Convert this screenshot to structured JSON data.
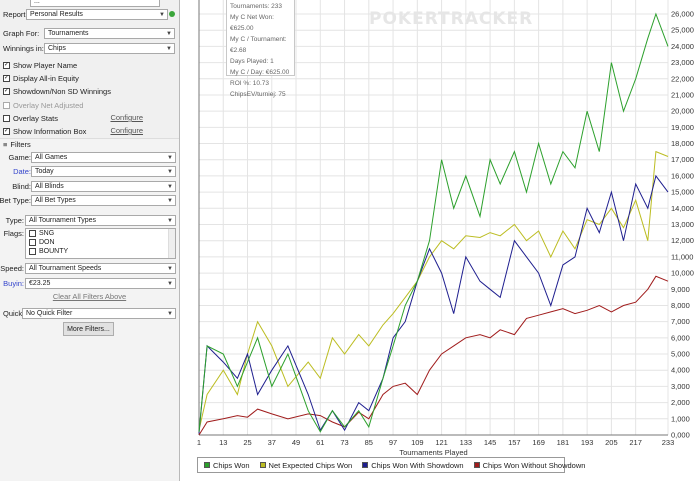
{
  "sidebar": {
    "top_value": "...",
    "report": {
      "label": "Report:",
      "value": "Personal Results"
    },
    "graph_for": {
      "label": "Graph For:",
      "value": "Tournaments"
    },
    "winnings_in": {
      "label": "Winnings in:",
      "value": "Chips"
    },
    "checks": {
      "show_player_name": "Show Player Name",
      "display_allin_equity": "Display All-in Equity",
      "showdown_winnings": "Showdown/Non SD Winnings",
      "overlay_net_adjusted": "Overlay Net Adjusted",
      "overlay_stats": "Overlay Stats",
      "show_info_box": "Show Information Box",
      "configure": "Configure"
    },
    "filters": {
      "header": "Filters",
      "game": {
        "label": "Game:",
        "value": "All Games"
      },
      "date": {
        "label": "Date:",
        "value": "Today"
      },
      "blind": {
        "label": "Blind:",
        "value": "All Blinds"
      },
      "bet_type": {
        "label": "Bet Type:",
        "value": "All Bet Types"
      },
      "type": {
        "label": "Type:",
        "value": "All Tournament Types"
      },
      "flags": {
        "label": "Flags:",
        "items": [
          "SNG",
          "DON",
          "BOUNTY"
        ]
      },
      "speed": {
        "label": "Speed:",
        "value": "All Tournament Speeds"
      },
      "buyin": {
        "label": "Buyin:",
        "value": "€23.25"
      },
      "clear_all": "Clear All Filters Above",
      "quick": {
        "label": "Quick:",
        "value": "No Quick Filter"
      },
      "more_filters": "More Filters..."
    }
  },
  "info_box": {
    "lines": [
      "Tournaments: 233",
      "My C Net Won: €625.00",
      "My C / Tournament: €2.68",
      "Days Played: 1",
      "My C / Day: €625.00",
      "ROI %: 10.73",
      "ChipsEV/turniej: 75"
    ]
  },
  "watermark": "POKERTRACKER",
  "chart_data": {
    "type": "line",
    "xlabel": "Tournaments Played",
    "x_ticks": [
      1,
      13,
      25,
      37,
      49,
      61,
      73,
      85,
      97,
      109,
      121,
      133,
      145,
      157,
      169,
      181,
      193,
      205,
      217,
      233
    ],
    "xlim": [
      1,
      233
    ],
    "ylim": [
      0,
      26000
    ],
    "y_ticks": [
      0,
      1000,
      2000,
      3000,
      4000,
      5000,
      6000,
      7000,
      8000,
      9000,
      10000,
      11000,
      12000,
      13000,
      14000,
      15000,
      16000,
      17000,
      18000,
      19000,
      20000,
      21000,
      22000,
      23000,
      24000,
      25000,
      26000
    ],
    "y_tick_labels": [
      "0,000",
      "1,000",
      "2,000",
      "3,000",
      "4,000",
      "5,000",
      "6,000",
      "7,000",
      "8,000",
      "9,000",
      "10,000",
      "11,000",
      "12,000",
      "13,000",
      "14,000",
      "15,000",
      "16,000",
      "17,000",
      "18,000",
      "19,000",
      "20,000",
      "21,000",
      "22,000",
      "23,000",
      "24,000",
      "25,000",
      "26,000"
    ],
    "grid": true,
    "series": [
      {
        "name": "Chips Won",
        "color": "#2ca02c",
        "x": [
          1,
          5,
          13,
          20,
          25,
          30,
          37,
          45,
          55,
          61,
          67,
          73,
          80,
          85,
          92,
          97,
          103,
          109,
          115,
          121,
          127,
          133,
          140,
          145,
          150,
          157,
          163,
          169,
          175,
          181,
          187,
          193,
          199,
          205,
          211,
          217,
          223,
          227,
          233
        ],
        "y": [
          200,
          5500,
          5000,
          3000,
          4500,
          6000,
          3000,
          5000,
          1500,
          200,
          1500,
          500,
          1500,
          500,
          3500,
          5500,
          8000,
          9500,
          12000,
          17000,
          14000,
          16000,
          13500,
          17000,
          15500,
          17500,
          15000,
          18000,
          15500,
          17500,
          16500,
          20000,
          17500,
          23000,
          20000,
          22000,
          24500,
          26000,
          24000
        ]
      },
      {
        "name": "Net Expected Chips Won",
        "color": "#bcbd22",
        "x": [
          1,
          5,
          13,
          20,
          25,
          30,
          37,
          45,
          55,
          61,
          67,
          73,
          80,
          85,
          92,
          97,
          103,
          109,
          115,
          121,
          127,
          133,
          140,
          145,
          150,
          157,
          163,
          169,
          175,
          181,
          187,
          193,
          199,
          205,
          211,
          217,
          223,
          227,
          233
        ],
        "y": [
          300,
          2500,
          4000,
          2500,
          5000,
          7000,
          5500,
          3000,
          4500,
          3500,
          6000,
          5000,
          6200,
          5500,
          6800,
          7500,
          8500,
          9500,
          11000,
          12000,
          11500,
          12300,
          12200,
          12500,
          12300,
          13000,
          12000,
          12600,
          11000,
          12600,
          11500,
          13300,
          13000,
          14000,
          12800,
          14500,
          12000,
          17500,
          17200
        ]
      },
      {
        "name": "Chips Won With Showdown",
        "color": "#1f1f8f",
        "x": [
          1,
          5,
          13,
          20,
          25,
          30,
          37,
          45,
          55,
          61,
          67,
          73,
          80,
          85,
          92,
          97,
          103,
          109,
          115,
          121,
          127,
          133,
          140,
          145,
          150,
          157,
          163,
          169,
          175,
          181,
          187,
          193,
          199,
          205,
          211,
          217,
          223,
          227,
          233
        ],
        "y": [
          100,
          5500,
          4500,
          3500,
          5000,
          2500,
          4000,
          5500,
          2500,
          300,
          1500,
          300,
          2000,
          1500,
          3500,
          6000,
          7000,
          9500,
          11500,
          10000,
          7500,
          11000,
          9500,
          9000,
          8500,
          12000,
          11000,
          10000,
          8000,
          10500,
          11000,
          14000,
          12500,
          15000,
          12000,
          15500,
          14000,
          16000,
          15000
        ]
      },
      {
        "name": "Chips Won Without Showdown",
        "color": "#a01c1c",
        "x": [
          1,
          5,
          13,
          20,
          25,
          30,
          37,
          45,
          55,
          61,
          67,
          73,
          80,
          85,
          92,
          97,
          103,
          109,
          115,
          121,
          127,
          133,
          140,
          145,
          150,
          157,
          163,
          169,
          175,
          181,
          187,
          193,
          199,
          205,
          211,
          217,
          223,
          227,
          233
        ],
        "y": [
          0,
          800,
          1000,
          1200,
          1100,
          1600,
          1300,
          1000,
          1300,
          1200,
          800,
          500,
          1400,
          1000,
          2500,
          3000,
          3200,
          2500,
          4000,
          5000,
          5500,
          6000,
          6200,
          6000,
          6500,
          6200,
          7200,
          7400,
          7600,
          7800,
          7500,
          7700,
          8000,
          7600,
          8000,
          8200,
          9000,
          9800,
          9500
        ]
      }
    ]
  }
}
